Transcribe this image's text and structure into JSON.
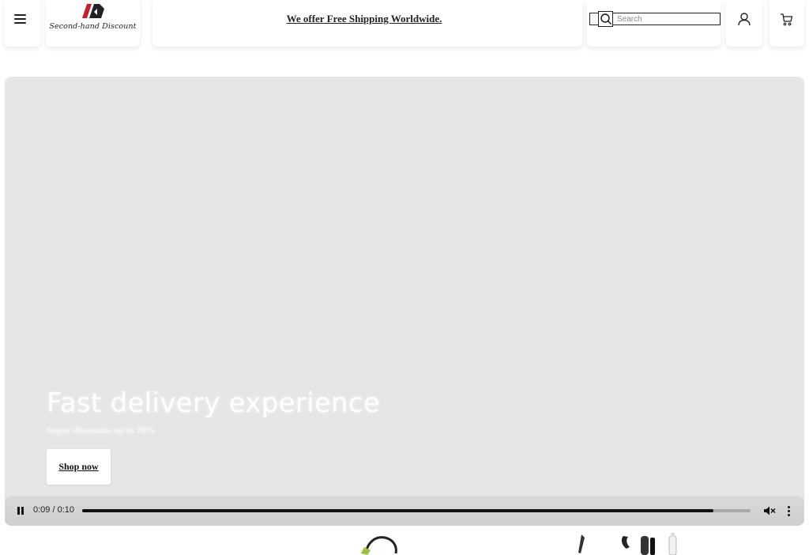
{
  "header": {
    "logo_text": "Second-hand Discount",
    "announcement": "We offer Free Shipping Worldwide.",
    "search_placeholder": "Search",
    "icons": [
      "menu-icon",
      "search-icon",
      "account-icon",
      "cart-icon"
    ],
    "brand_color": "#c81e2a"
  },
  "hero": {
    "title": "Fast delivery experience",
    "subtitle": "Super discounts up to 70%",
    "cta_label": "Shop now",
    "background": "#e6e6e6"
  },
  "video": {
    "time_display": "0:09 / 0:10",
    "progress": 0.945,
    "state": "playing",
    "muted": true,
    "icons": [
      "pause-icon",
      "mute-icon",
      "more-options-icon"
    ]
  }
}
